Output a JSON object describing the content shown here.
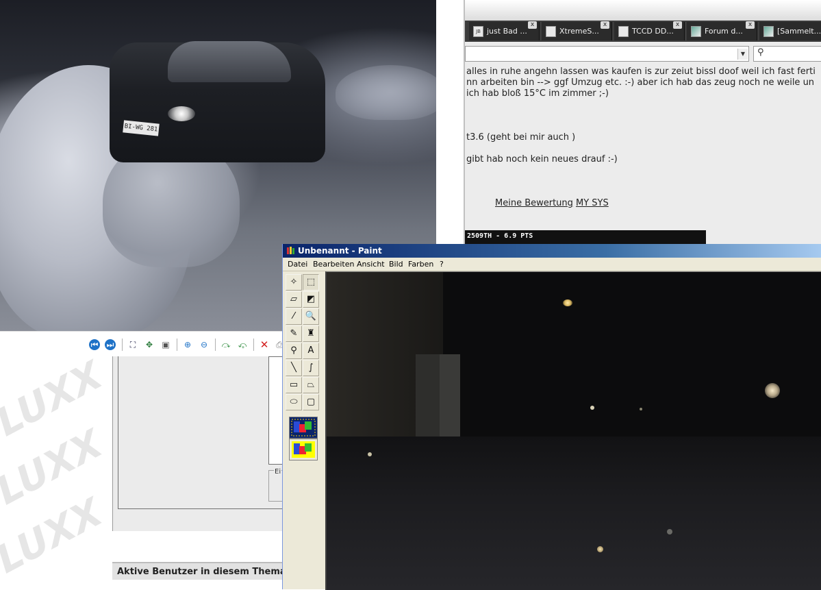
{
  "viewer": {
    "car_plate": "BI-WG 281",
    "toolbar_icons": [
      "previous-icon",
      "next-icon",
      "best-fit-icon",
      "actual-size-icon",
      "slideshow-icon",
      "zoom-in-icon",
      "zoom-out-icon",
      "rotate-clockwise-icon",
      "rotate-counterclockwise-icon",
      "delete-icon",
      "print-icon"
    ]
  },
  "browser": {
    "tabs": [
      {
        "title": "just Bad ...",
        "icon": "JB"
      },
      {
        "title": "XtremeS...",
        "icon": ""
      },
      {
        "title": "TCCD DD...",
        "icon": ""
      },
      {
        "title": "Forum d...",
        "icon": ""
      },
      {
        "title": "[Sammelt...",
        "icon": ""
      }
    ],
    "tab_close": "x",
    "content": {
      "line1": "alles in ruhe angehn lassen was kaufen is zur zeiut bissl doof weil ich fast ferti",
      "line2": "nn arbeiten bin --> ggf Umzug etc. :-) aber ich hab das zeug noch ne weile un",
      "line3": "ich hab bloß 15°C im zimmer ;-)",
      "line4": "t3.6 (geht bei mir auch )",
      "line5": "gibt hab noch kein neues drauf :-)",
      "link_rating": "Meine Bewertung",
      "link_sys": "MY SYS",
      "sig": "2509TH - 6.9 PTS"
    }
  },
  "forum": {
    "watermark": "LUXX",
    "group_label": "Ei",
    "active_users": "Aktive Benutzer in diesem Thema"
  },
  "paint": {
    "title": "Unbenannt - Paint",
    "menu": [
      "Datei",
      "Bearbeiten",
      "Ansicht",
      "Bild",
      "Farben",
      "?"
    ],
    "tools": [
      {
        "name": "free-form-select-icon",
        "glyph": "✧"
      },
      {
        "name": "rect-select-icon",
        "glyph": "⬚"
      },
      {
        "name": "eraser-icon",
        "glyph": "▱"
      },
      {
        "name": "fill-icon",
        "glyph": "◩"
      },
      {
        "name": "color-picker-icon",
        "glyph": "⁄"
      },
      {
        "name": "magnifier-icon",
        "glyph": "🔍"
      },
      {
        "name": "pencil-icon",
        "glyph": "✎"
      },
      {
        "name": "brush-icon",
        "glyph": "♜"
      },
      {
        "name": "airbrush-icon",
        "glyph": "⚲"
      },
      {
        "name": "text-icon",
        "glyph": "A"
      },
      {
        "name": "line-icon",
        "glyph": "╲"
      },
      {
        "name": "curve-icon",
        "glyph": "∫"
      },
      {
        "name": "rectangle-icon",
        "glyph": "▭"
      },
      {
        "name": "polygon-icon",
        "glyph": "⏢"
      },
      {
        "name": "ellipse-icon",
        "glyph": "⬭"
      },
      {
        "name": "rounded-rect-icon",
        "glyph": "▢"
      }
    ]
  },
  "colors": {
    "paint_title_start": "#0a246a",
    "paint_title_end": "#a6caf0",
    "tab_bg": "#2b2b2b",
    "viewer_nav": "#1e72c7"
  }
}
